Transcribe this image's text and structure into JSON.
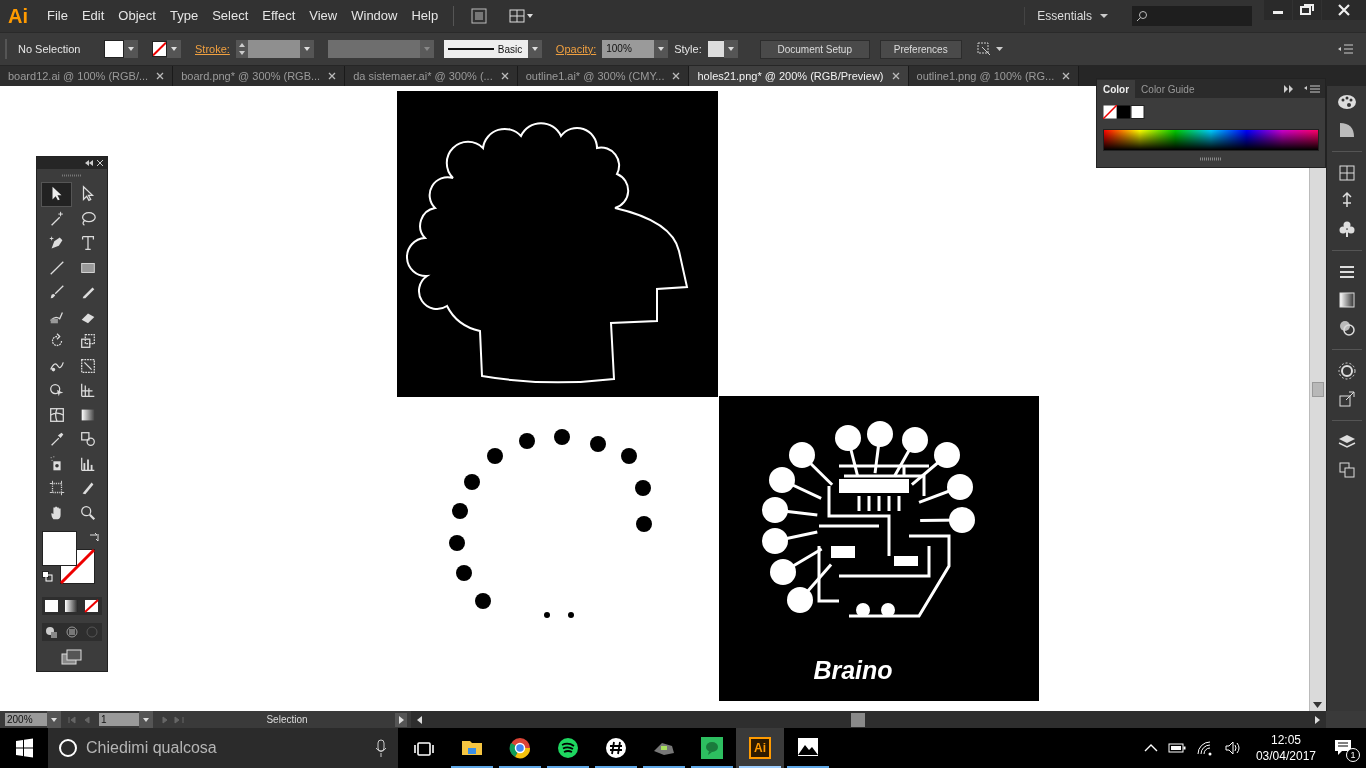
{
  "app": {
    "logo": "Ai"
  },
  "menu": [
    "File",
    "Edit",
    "Object",
    "Type",
    "Select",
    "Effect",
    "View",
    "Window",
    "Help"
  ],
  "workspace": {
    "label": "Essentials"
  },
  "control_bar": {
    "selection": "No Selection",
    "fill_none": false,
    "stroke_none": true,
    "stroke_label": "Stroke:",
    "brush": "Basic",
    "opacity_label": "Opacity:",
    "opacity": "100%",
    "style_label": "Style:",
    "buttons": [
      "Document Setup",
      "Preferences"
    ]
  },
  "tabs": [
    {
      "label": "board12.ai @ 100% (RGB/...",
      "selected": false
    },
    {
      "label": "board.png* @ 300% (RGB...",
      "selected": false
    },
    {
      "label": "da sistemaer.ai* @ 300% (...",
      "selected": false
    },
    {
      "label": "outline1.ai* @ 300% (CMY...",
      "selected": false
    },
    {
      "label": "holes21.png* @ 200% (RGB/Preview)",
      "selected": true
    },
    {
      "label": "outline1.png @ 100% (RG...",
      "selected": false
    }
  ],
  "toolbox": {
    "tools": [
      {
        "selected": true
      },
      {
        "selected": false
      },
      {
        "selected": false
      },
      {
        "selected": false
      },
      {
        "selected": false
      },
      {
        "selected": false
      },
      {
        "selected": false
      },
      {
        "selected": false
      },
      {
        "selected": false
      },
      {
        "selected": false
      },
      {
        "selected": false
      },
      {
        "selected": false
      },
      {
        "selected": false
      },
      {
        "selected": false
      },
      {
        "selected": false
      },
      {
        "selected": false
      },
      {
        "selected": false
      },
      {
        "selected": false
      },
      {
        "selected": false
      },
      {
        "selected": false
      },
      {
        "selected": false
      },
      {
        "selected": false
      },
      {
        "selected": false
      },
      {
        "selected": false
      },
      {
        "selected": false
      },
      {
        "selected": false
      },
      {
        "selected": false
      },
      {
        "selected": false
      }
    ],
    "fill_none": false,
    "stroke_none": true
  },
  "color_panel": {
    "tabs": [
      {
        "label": "Color",
        "selected": true
      },
      {
        "label": "Color Guide",
        "selected": false
      }
    ]
  },
  "artwork": {
    "caption": "Braino"
  },
  "status_bar": {
    "zoom": "200%",
    "artboard": "1",
    "tool": "Selection"
  },
  "taskbar": {
    "search_placeholder": "Chiedimi qualcosa",
    "apps": [
      {
        "kind": "taskview",
        "selected": false
      },
      {
        "kind": "folder",
        "selected": false
      },
      {
        "kind": "browser",
        "selected": false
      },
      {
        "kind": "music",
        "selected": false
      },
      {
        "kind": "chat",
        "selected": false
      },
      {
        "kind": "tool",
        "selected": false
      },
      {
        "kind": "notes",
        "selected": false
      },
      {
        "kind": "illustrator",
        "label": "Ai",
        "selected": true
      },
      {
        "kind": "photos",
        "selected": false
      }
    ],
    "time": "12:05",
    "date": "03/04/2017",
    "notifications": "1"
  }
}
